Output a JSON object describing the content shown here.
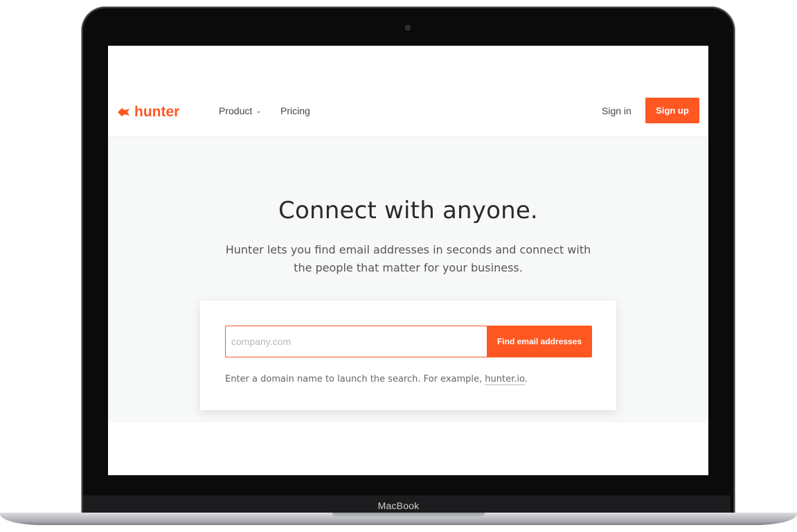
{
  "device": {
    "label": "MacBook"
  },
  "header": {
    "brand": "hunter",
    "nav": {
      "product": "Product",
      "pricing": "Pricing"
    },
    "sign_in": "Sign in",
    "sign_up": "Sign up"
  },
  "hero": {
    "title": "Connect with anyone.",
    "subtitle": "Hunter lets you find email addresses in seconds and connect with the people that matter for your business."
  },
  "search": {
    "placeholder": "company.com",
    "value": "",
    "button_label": "Find email addresses",
    "hint_text": "Enter a domain name to launch the search. For example,",
    "hint_link": "hunter.io",
    "hint_end": "."
  },
  "colors": {
    "accent": "#ff5722",
    "hero_bg": "#f7f8f8",
    "bezel": "#0b0b0b"
  },
  "icons": {
    "logo": "hunter-logo-icon",
    "product_chevron": "chevron-down-icon"
  }
}
